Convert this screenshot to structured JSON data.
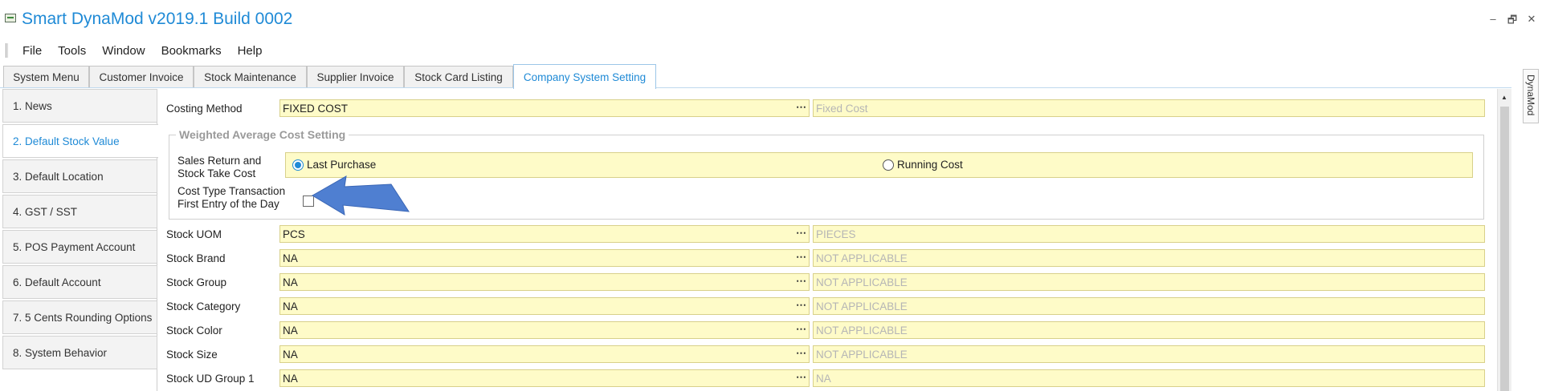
{
  "window": {
    "title": "Smart DynaMod v2019.1 Build 0002",
    "minimize": "–",
    "restore": "🗗",
    "close": "✕"
  },
  "menu": {
    "items": [
      "File",
      "Tools",
      "Window",
      "Bookmarks",
      "Help"
    ]
  },
  "tabs": [
    {
      "label": "System Menu"
    },
    {
      "label": "Customer Invoice"
    },
    {
      "label": "Stock Maintenance"
    },
    {
      "label": "Supplier Invoice"
    },
    {
      "label": "Stock Card Listing"
    },
    {
      "label": "Company System Setting",
      "active": true
    }
  ],
  "nav": {
    "items": [
      {
        "label": "1. News"
      },
      {
        "label": "2. Default Stock Value",
        "active": true
      },
      {
        "label": "3. Default Location"
      },
      {
        "label": "4. GST / SST"
      },
      {
        "label": "5. POS Payment Account"
      },
      {
        "label": "6. Default Account"
      },
      {
        "label": "7. 5 Cents Rounding Options"
      },
      {
        "label": "8. System Behavior"
      }
    ]
  },
  "form": {
    "costing_method": {
      "label": "Costing Method",
      "value": "FIXED COST",
      "description": "Fixed Cost"
    },
    "weighted_group": {
      "title": "Weighted Average Cost Setting",
      "sales_return_label_1": "Sales Return and",
      "sales_return_label_2": "Stock Take Cost",
      "option_last_purchase": "Last Purchase",
      "option_running_cost": "Running Cost",
      "selected_option": "Last Purchase",
      "cost_type_label_1": "Cost Type Transaction",
      "cost_type_label_2": "First Entry of the Day",
      "cost_type_checked": false
    },
    "rows": [
      {
        "label": "Stock UOM",
        "value": "PCS",
        "description": "PIECES"
      },
      {
        "label": "Stock Brand",
        "value": "NA",
        "description": "NOT APPLICABLE"
      },
      {
        "label": "Stock Group",
        "value": "NA",
        "description": "NOT APPLICABLE"
      },
      {
        "label": "Stock Category",
        "value": "NA",
        "description": "NOT APPLICABLE"
      },
      {
        "label": "Stock Color",
        "value": "NA",
        "description": "NOT APPLICABLE"
      },
      {
        "label": "Stock Size",
        "value": "NA",
        "description": "NOT APPLICABLE"
      },
      {
        "label": "Stock UD Group 1",
        "value": "NA",
        "description": "NA"
      }
    ],
    "lookup_glyph": "⋯"
  },
  "side_panel": {
    "label": "DynaMod"
  },
  "colors": {
    "accent": "#1f8ad6",
    "field_background": "#fefbc8",
    "arrow_fill": "#4f7fd1"
  }
}
